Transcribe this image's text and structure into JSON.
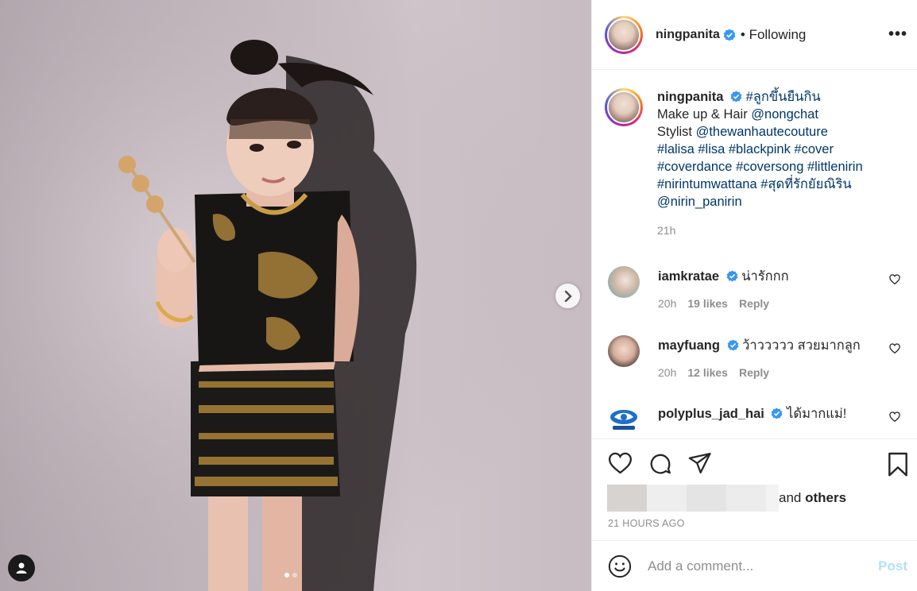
{
  "header": {
    "username": "ningpanita",
    "following_label": "• Following",
    "more_label": "•••"
  },
  "caption": {
    "username": "ningpanita",
    "lines": [
      "#ลูกขึ้นยืนกิน",
      "Make up & Hair ",
      "@nongchat",
      "Stylist ",
      "@thewanhautecouture",
      "#lalisa #lisa #blackpink #cover",
      "#coverdance #coversong #littlenirin",
      "#nirintumwattana #สุดที่รักยัยณิริน",
      "@nirin_panirin"
    ],
    "time": "21h"
  },
  "comments": [
    {
      "username": "iamkratae",
      "text": "น่ารักกก",
      "time": "20h",
      "likes": "19 likes",
      "reply": "Reply"
    },
    {
      "username": "mayfuang",
      "text": "ว้าววววว สวยมากลูก",
      "time": "20h",
      "likes": "12 likes",
      "reply": "Reply"
    },
    {
      "username": "polyplus_jad_hai",
      "text": "ได้มากแม่!"
    }
  ],
  "likes": {
    "suffix_plain": "and ",
    "suffix_bold": "others"
  },
  "posted_ago": "21 HOURS AGO",
  "add_comment": {
    "placeholder": "Add a comment...",
    "post_label": "Post"
  },
  "colors": {
    "link": "#00376b",
    "verified": "#3897f0",
    "muted": "#8e8e8e",
    "post_disabled": "#b2dffc"
  },
  "carousel": {
    "slide": 1,
    "total": 2
  }
}
